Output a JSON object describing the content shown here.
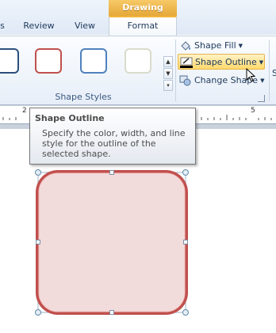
{
  "context_tab": {
    "label": "Drawing Tools"
  },
  "tabs": [
    {
      "label": "s"
    },
    {
      "label": "Review"
    },
    {
      "label": "View"
    },
    {
      "label": "Format"
    }
  ],
  "shape_styles": {
    "group_label": "Shape Styles",
    "swatches": [
      {
        "color": "#2c4f7c"
      },
      {
        "color": "#c0504d"
      },
      {
        "color": "#4f81bd"
      },
      {
        "color": "#c8ccb4"
      }
    ]
  },
  "commands": {
    "fill": "Shape Fill",
    "outline": "Shape Outline",
    "change": "Change Shape"
  },
  "ribbon_partial_letter": "S",
  "ruler": {
    "labels": [
      "2",
      "5"
    ]
  },
  "tooltip": {
    "title": "Shape Outline",
    "body": "Specify the color, width, and line style for the outline of the selected shape."
  },
  "shape": {
    "fill": "#f2dbdb",
    "outline": "#c0504d"
  }
}
